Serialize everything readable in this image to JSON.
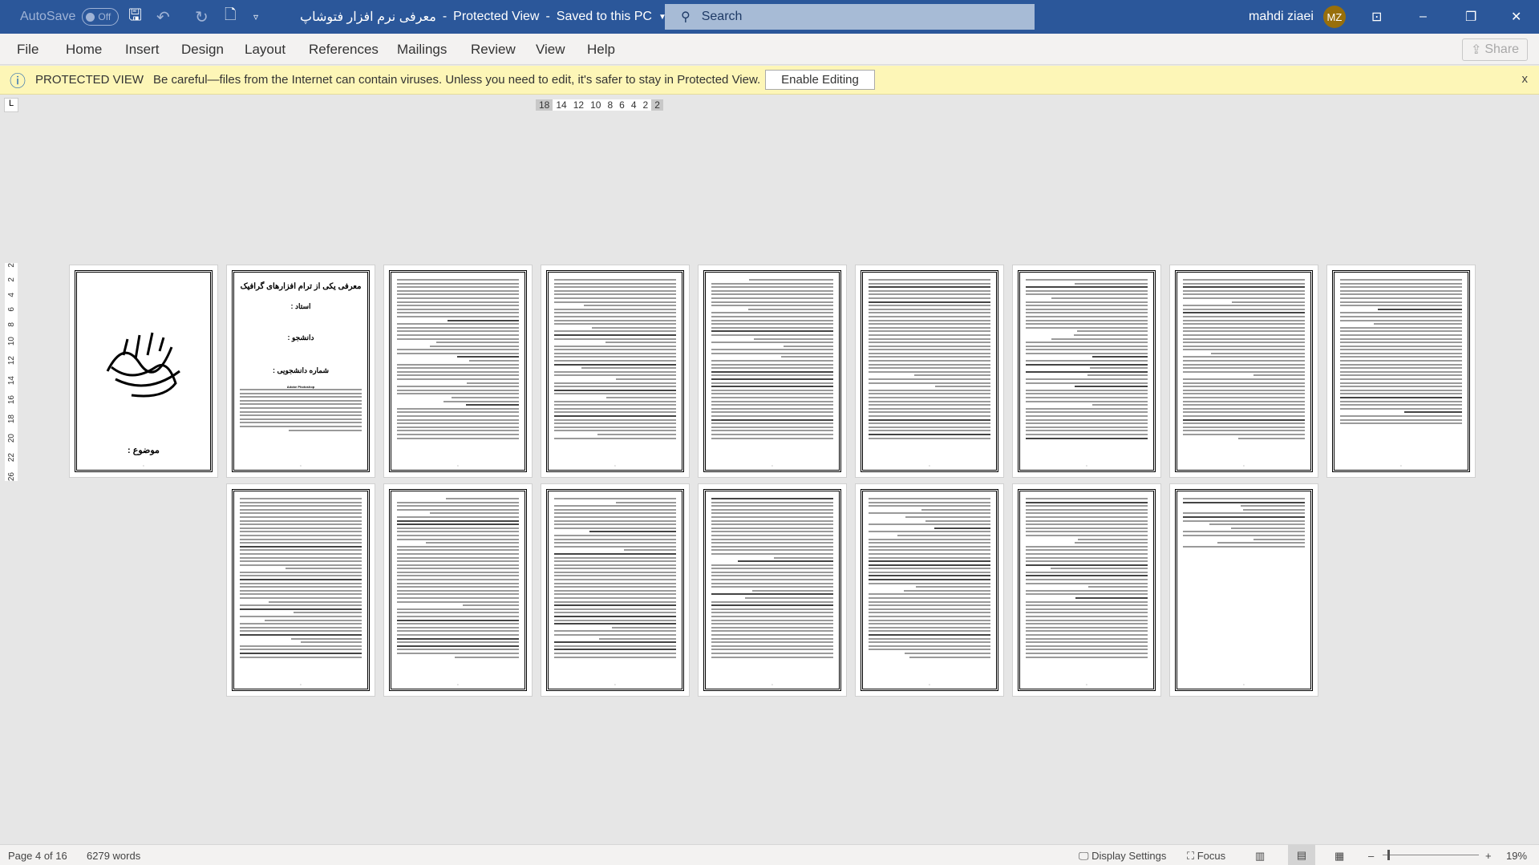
{
  "titlebar": {
    "autosave": "AutoSave",
    "autosave_state": "Off",
    "doc_title": "معرفی نرم افزار فتوشاپ",
    "mode": "Protected View",
    "saved": "Saved to this PC",
    "search": "Search",
    "user": "mahdi ziaei",
    "initials": "MZ",
    "avatar_color": "#986f0b"
  },
  "menu": {
    "tabs": [
      "File",
      "Home",
      "Insert",
      "Design",
      "Layout",
      "References",
      "Mailings",
      "Review",
      "View",
      "Help"
    ],
    "share": "Share"
  },
  "protected": {
    "label": "PROTECTED VIEW",
    "message": "Be careful—files from the Internet can contain viruses. Unless you need to edit, it's safer to stay in Protected View.",
    "enable": "Enable Editing",
    "close": "x"
  },
  "ruler": {
    "h": [
      "18",
      "14",
      "12",
      "10",
      "8",
      "6",
      "4",
      "2",
      "2"
    ],
    "v": [
      "2",
      "2",
      "4",
      "6",
      "8",
      "10",
      "12",
      "14",
      "16",
      "18",
      "20",
      "22",
      "26"
    ],
    "tab_stop": "L"
  },
  "pages": {
    "p1": {
      "bottom": "موضوع :"
    },
    "p2": {
      "title": "معرفی یکی از ترام افزارهای گرافیک",
      "l1": "استاد :",
      "l2": "دانشجو :",
      "l3": "شماره دانشجویی :",
      "l4": "Adobe Photoshop"
    },
    "count": 16
  },
  "status": {
    "page": "Page 4 of 16",
    "words": "6279 words",
    "display": "Display Settings",
    "focus": "Focus",
    "zoom": "19%"
  },
  "colors": {
    "titlebar": "#2b579a",
    "protected_bg": "#fdf6b7"
  }
}
